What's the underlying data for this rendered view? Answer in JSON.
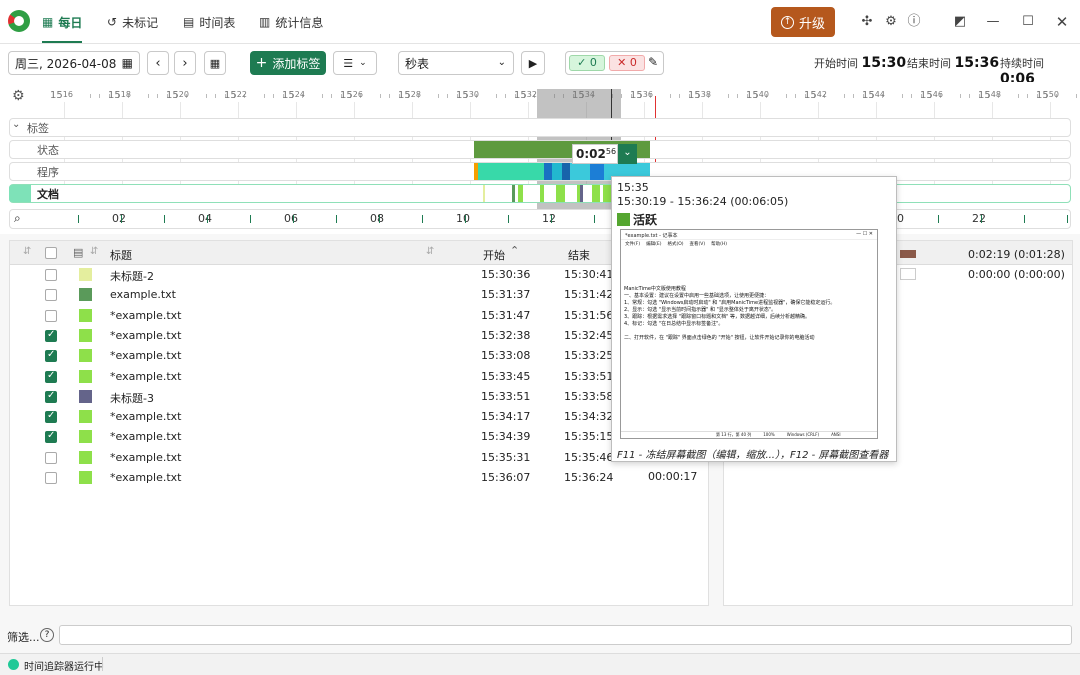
{
  "titlebar": {
    "tabs": [
      {
        "label": "每日",
        "icon": "calendar-icon"
      },
      {
        "label": "未标记",
        "icon": "history-icon"
      },
      {
        "label": "时间表",
        "icon": "document-icon"
      },
      {
        "label": "统计信息",
        "icon": "bar-chart-icon"
      }
    ],
    "upgrade_label": "升级"
  },
  "toolbar": {
    "date": "周三, 2026-04-08",
    "add_tag_label": "添加标签",
    "unit": "秒表",
    "accept_count": "0",
    "reject_count": "0",
    "start_label": "开始时间",
    "start_value": "15:30",
    "end_label": "结束时间",
    "end_value": "15:36",
    "duration_label": "持续时间",
    "duration_value": "0:06"
  },
  "timeline": {
    "ticks": [
      {
        "h": "15",
        "m": "16"
      },
      {
        "h": "15",
        "m": "18"
      },
      {
        "h": "15",
        "m": "20"
      },
      {
        "h": "15",
        "m": "22"
      },
      {
        "h": "15",
        "m": "24"
      },
      {
        "h": "15",
        "m": "26"
      },
      {
        "h": "15",
        "m": "28"
      },
      {
        "h": "15",
        "m": "30"
      },
      {
        "h": "15",
        "m": "32"
      },
      {
        "h": "15",
        "m": "34"
      },
      {
        "h": "15",
        "m": "36"
      },
      {
        "h": "15",
        "m": "38"
      },
      {
        "h": "15",
        "m": "40"
      },
      {
        "h": "15",
        "m": "42"
      },
      {
        "h": "15",
        "m": "44"
      },
      {
        "h": "15",
        "m": "46"
      },
      {
        "h": "15",
        "m": "48"
      },
      {
        "h": "15",
        "m": "50"
      }
    ],
    "lanes": [
      "标签",
      "状态",
      "程序",
      "文档"
    ],
    "selection_duration": "0:02",
    "selection_seconds": "56",
    "hours": [
      "02",
      "04",
      "06",
      "08",
      "10",
      "12",
      "20",
      "22"
    ]
  },
  "table": {
    "columns": {
      "title": "标题",
      "start": "开始",
      "end": "结束"
    },
    "rows": [
      {
        "checked": false,
        "color": "#e4ee9e",
        "title": "未标题-2",
        "start": "15:30:36",
        "end": "15:30:41"
      },
      {
        "checked": false,
        "color": "#5a9a5a",
        "title": "example.txt",
        "start": "15:31:37",
        "end": "15:31:42"
      },
      {
        "checked": false,
        "color": "#8ee04a",
        "title": "*example.txt",
        "start": "15:31:47",
        "end": "15:31:56"
      },
      {
        "checked": true,
        "color": "#8ee04a",
        "title": "*example.txt",
        "start": "15:32:38",
        "end": "15:32:45"
      },
      {
        "checked": true,
        "color": "#8ee04a",
        "title": "*example.txt",
        "start": "15:33:08",
        "end": "15:33:25"
      },
      {
        "checked": true,
        "color": "#8ee04a",
        "title": "*example.txt",
        "start": "15:33:45",
        "end": "15:33:51"
      },
      {
        "checked": true,
        "color": "#64648a",
        "title": "未标题-3",
        "start": "15:33:51",
        "end": "15:33:58"
      },
      {
        "checked": true,
        "color": "#8ee04a",
        "title": "*example.txt",
        "start": "15:34:17",
        "end": "15:34:32"
      },
      {
        "checked": true,
        "color": "#8ee04a",
        "title": "*example.txt",
        "start": "15:34:39",
        "end": "15:35:15"
      },
      {
        "checked": false,
        "color": "#8ee04a",
        "title": "*example.txt",
        "start": "15:35:31",
        "end": "15:35:46"
      },
      {
        "checked": false,
        "color": "#8ee04a",
        "title": "*example.txt",
        "start": "15:36:07",
        "end": "15:36:24"
      }
    ],
    "last_duration": "00:00:17"
  },
  "rightpane": {
    "items": [
      {
        "value": "0:02:19 (0:01:28)"
      },
      {
        "value": "0:00:00 (0:00:00)"
      }
    ]
  },
  "popup": {
    "time": "15:35",
    "range": "15:30:19 - 15:36:24 (00:06:05)",
    "status": "活跃",
    "notepad_title": "*example.txt - 记事本",
    "notepad_menu": [
      "文件(F)",
      "编辑(E)",
      "格式(O)",
      "查看(V)",
      "帮助(H)"
    ],
    "notepad_lines": [
      "ManicTime中文版使用教程",
      "一、基本设置：建议在设置中启用一些基础选项，让使用更便捷：",
      "1、常规：勾选 \"Windows启动时启动\" 和 \"启用ManicTime进程监视器\"，确保它能稳定运行。",
      "2、显示：勾选 \"显示当前时间指示器\" 和 \"显示整体处于离开状态\"。",
      "3、跟踪：根据需求选择 \"跟踪窗口标题和文档\" 等，数据越详细，后续分析越精确。",
      "4、标记：勾选 \"在日总结中显示标签备注\"。",
      "二、打开软件，在 \"跟踪\" 界面点击绿色的 \"开始\" 按钮，让软件开始记录你的电脑活动"
    ],
    "notepad_status": [
      "第 13 行，第 40 列",
      "100%",
      "Windows (CRLF)",
      "ANSI"
    ],
    "hint": "F11 - 冻结屏幕截图（编辑，缩放...），F12 - 屏幕截图查看器"
  },
  "filter": {
    "label": "筛选...",
    "help": "?"
  },
  "status": {
    "text": "时间追踪器运行中"
  }
}
